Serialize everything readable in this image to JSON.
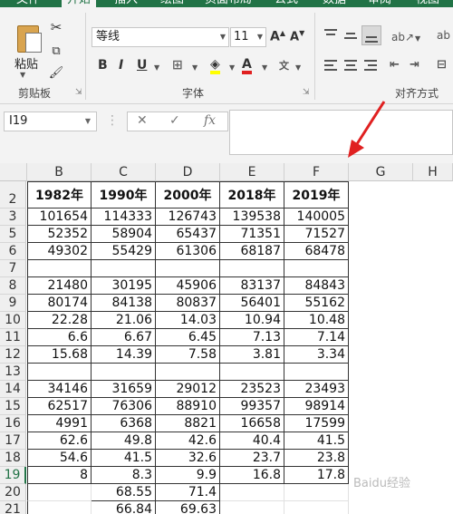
{
  "ribbon": {
    "tabs": [
      "文件",
      "开始",
      "插入",
      "绘图",
      "页面布局",
      "公式",
      "数据",
      "审阅",
      "视图"
    ],
    "active_tab": "开始",
    "clipboard": {
      "paste_label": "粘贴",
      "group_label": "剪贴板"
    },
    "font": {
      "name": "等线",
      "size": "11",
      "group_label": "字体"
    },
    "alignment": {
      "group_label": "对齐方式"
    }
  },
  "formula_bar": {
    "name_box": "I19",
    "fx": "fx",
    "value": ""
  },
  "colors": {
    "accent": "#217346",
    "annotation": "#e02020"
  },
  "columns": [
    "B",
    "C",
    "D",
    "E",
    "F",
    "G",
    "H"
  ],
  "rows": [
    {
      "num": "2",
      "cells": [
        "1982年",
        "1990年",
        "2000年",
        "2018年",
        "2019年"
      ]
    },
    {
      "num": "3",
      "cells": [
        "101654",
        "114333",
        "126743",
        "139538",
        "140005"
      ]
    },
    {
      "num": "5",
      "cells": [
        "52352",
        "58904",
        "65437",
        "71351",
        "71527"
      ]
    },
    {
      "num": "6",
      "cells": [
        "49302",
        "55429",
        "61306",
        "68187",
        "68478"
      ]
    },
    {
      "num": "7",
      "cells": [
        "",
        "",
        "",
        "",
        ""
      ]
    },
    {
      "num": "8",
      "cells": [
        "21480",
        "30195",
        "45906",
        "83137",
        "84843"
      ]
    },
    {
      "num": "9",
      "cells": [
        "80174",
        "84138",
        "80837",
        "56401",
        "55162"
      ]
    },
    {
      "num": "10",
      "cells": [
        "22.28",
        "21.06",
        "14.03",
        "10.94",
        "10.48"
      ]
    },
    {
      "num": "11",
      "cells": [
        "6.6",
        "6.67",
        "6.45",
        "7.13",
        "7.14"
      ]
    },
    {
      "num": "12",
      "cells": [
        "15.68",
        "14.39",
        "7.58",
        "3.81",
        "3.34"
      ]
    },
    {
      "num": "13",
      "cells": [
        "",
        "",
        "",
        "",
        ""
      ]
    },
    {
      "num": "14",
      "cells": [
        "34146",
        "31659",
        "29012",
        "23523",
        "23493"
      ]
    },
    {
      "num": "15",
      "cells": [
        "62517",
        "76306",
        "88910",
        "99357",
        "98914"
      ]
    },
    {
      "num": "16",
      "cells": [
        "4991",
        "6368",
        "8821",
        "16658",
        "17599"
      ]
    },
    {
      "num": "17",
      "cells": [
        "62.6",
        "49.8",
        "42.6",
        "40.4",
        "41.5"
      ]
    },
    {
      "num": "18",
      "cells": [
        "54.6",
        "41.5",
        "32.6",
        "23.7",
        "23.8"
      ]
    },
    {
      "num": "19",
      "cells": [
        "8",
        "8.3",
        "9.9",
        "16.8",
        "17.8"
      ]
    },
    {
      "num": "20",
      "cells": [
        "",
        "68.55",
        "71.4",
        "",
        ""
      ]
    },
    {
      "num": "21",
      "cells": [
        "",
        "66.84",
        "69.63",
        "",
        ""
      ]
    }
  ],
  "selected_row": "19",
  "watermark": "Baidu经验"
}
